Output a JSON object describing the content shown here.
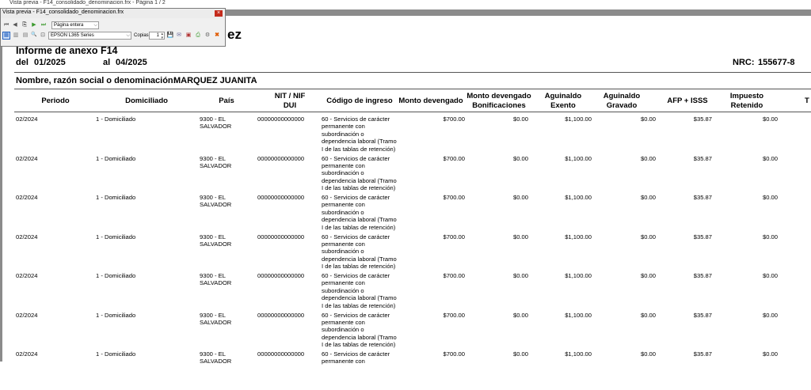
{
  "window": {
    "title": "Vista previa - F14_consolidado_denominacion.frx - Página 1 / 2"
  },
  "report": {
    "title": "Informe de anexo F14",
    "title_partial": "ez",
    "del_label": "del",
    "del_value": "01/2025",
    "al_label": "al",
    "al_value": "04/2025",
    "nrc_label": "NRC:",
    "nrc_value": "155677-8",
    "nombre_label": "Nombre, razón social o denominación:",
    "nombre_value": "MARQUEZ JUANITA"
  },
  "table": {
    "columns": [
      "Periodo",
      "Domiciliado",
      "País",
      "NIT / NIF\nDUI",
      "Código de ingreso",
      "Monto devengado",
      "Monto devengado\nBonificaciones",
      "Aguinaldo\nExento",
      "Aguinaldo\nGravado",
      "AFP + ISSS",
      "Impuesto\nRetenido",
      "T"
    ],
    "rows": [
      [
        "02/2024",
        "1 - Domiciliado",
        "9300 - EL\nSALVADOR",
        "00000000000000",
        "60 - Servicios de carácter\npermanente con\nsubordinación o\ndependencia laboral (Tramo\nI de las tablas de retención)",
        "$700.00",
        "$0.00",
        "$1,100.00",
        "$0.00",
        "$35.87",
        "$0.00"
      ],
      [
        "02/2024",
        "1 - Domiciliado",
        "9300 - EL\nSALVADOR",
        "00000000000000",
        "60 - Servicios de carácter\npermanente con\nsubordinación o\ndependencia laboral (Tramo\nI de las tablas de retención)",
        "$700.00",
        "$0.00",
        "$1,100.00",
        "$0.00",
        "$35.87",
        "$0.00"
      ],
      [
        "02/2024",
        "1 - Domiciliado",
        "9300 - EL\nSALVADOR",
        "00000000000000",
        "60 - Servicios de carácter\npermanente con\nsubordinación o\ndependencia laboral (Tramo\nI de las tablas de retención)",
        "$700.00",
        "$0.00",
        "$1,100.00",
        "$0.00",
        "$35.87",
        "$0.00"
      ],
      [
        "02/2024",
        "1 - Domiciliado",
        "9300 - EL\nSALVADOR",
        "00000000000000",
        "60 - Servicios de carácter\npermanente con\nsubordinación o\ndependencia laboral (Tramo\nI de las tablas de retención)",
        "$700.00",
        "$0.00",
        "$1,100.00",
        "$0.00",
        "$35.87",
        "$0.00"
      ],
      [
        "02/2024",
        "1 - Domiciliado",
        "9300 - EL\nSALVADOR",
        "00000000000000",
        "60 - Servicios de carácter\npermanente con\nsubordinación o\ndependencia laboral (Tramo\nI de las tablas de retención)",
        "$700.00",
        "$0.00",
        "$1,100.00",
        "$0.00",
        "$35.87",
        "$0.00"
      ],
      [
        "02/2024",
        "1 - Domiciliado",
        "9300 - EL\nSALVADOR",
        "00000000000000",
        "60 - Servicios de carácter\npermanente con\nsubordinación o\ndependencia laboral (Tramo\nI de las tablas de retención)",
        "$700.00",
        "$0.00",
        "$1,100.00",
        "$0.00",
        "$35.87",
        "$0.00"
      ],
      [
        "02/2024",
        "1 - Domiciliado",
        "9300 - EL\nSALVADOR",
        "00000000000000",
        "60 - Servicios de carácter\npermanente con",
        "$700.00",
        "$0.00",
        "$1,100.00",
        "$0.00",
        "$35.87",
        "$0.00"
      ]
    ]
  },
  "dialog": {
    "title": "Vista previa - F14_consolidado_denominacion.frx",
    "zoom_value": "Página entera",
    "printer_value": "EPSON L365 Series",
    "copies_label": "Copias",
    "copies_value": "1",
    "close_glyph": "×",
    "icons": {
      "first": "⏮",
      "prev": "◀",
      "copy": "⎘",
      "next": "▶",
      "last": "⏭",
      "view1": "▦",
      "view2": "▥",
      "view3": "▤",
      "find": "🔍",
      "zoomfit": "⊡",
      "save": "💾",
      "email": "✉",
      "pdf": "▣",
      "print": "⎙",
      "settings": "⚙",
      "close": "✖"
    },
    "colors": {
      "close_red": "#c42b1c",
      "close_icon": "#e05a00",
      "accent_blue": "#1f5fbf"
    }
  }
}
